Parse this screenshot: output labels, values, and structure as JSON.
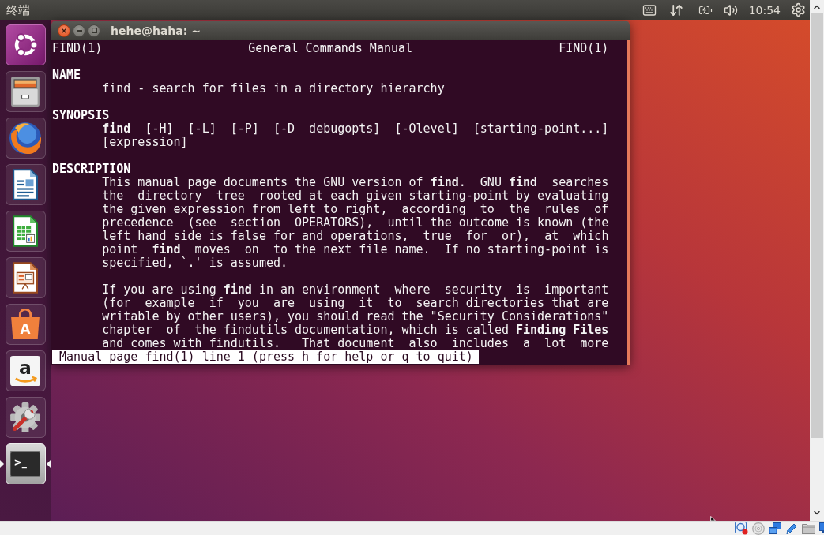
{
  "top_panel": {
    "app_title": "终端",
    "clock": "10:54"
  },
  "launcher": {
    "items": [
      {
        "kind": "dash",
        "running": false,
        "focused": false
      },
      {
        "kind": "files",
        "running": false,
        "focused": false
      },
      {
        "kind": "browser",
        "running": false,
        "focused": false
      },
      {
        "kind": "writer",
        "running": false,
        "focused": false
      },
      {
        "kind": "calc",
        "running": false,
        "focused": false
      },
      {
        "kind": "impress",
        "running": false,
        "focused": false
      },
      {
        "kind": "software",
        "glyph": "A",
        "running": false,
        "focused": false
      },
      {
        "kind": "store",
        "glyph": "a",
        "running": false,
        "focused": false
      },
      {
        "kind": "settings",
        "running": false,
        "focused": false
      },
      {
        "kind": "terminal",
        "glyph": ">_",
        "running": true,
        "focused": true
      }
    ]
  },
  "terminal": {
    "title": "hehe@haha: ~",
    "header": {
      "left": "FIND(1)",
      "center": "General Commands Manual",
      "right": "FIND(1)"
    },
    "sections": [
      {
        "heading": "NAME",
        "paragraphs": [
          {
            "lines": [
              "find - search for files in a directory hierarchy"
            ]
          }
        ]
      },
      {
        "heading": "SYNOPSIS",
        "paragraphs": [
          {
            "lines": [
              "**find**  [-H]  [-L]  [-P]  [-D  debugopts]  [-Olevel]  [starting-point...]",
              "[expression]"
            ]
          }
        ]
      },
      {
        "heading": "DESCRIPTION",
        "paragraphs": [
          {
            "lines": [
              "This manual page documents the GNU version of **find**.  GNU **find**  searches",
              "the  directory  tree  rooted at each given starting-point by evaluating",
              "the given expression from left to right,  according  to  the  rules  of",
              "precedence  (see  section  OPERATORS),  until the outcome is known (the",
              "left hand side is false for *and* operations,  true  for  *or*),  at  which",
              "point  **find**  moves  on  to the next file name.  If no starting-point is",
              "specified, `.' is assumed."
            ]
          },
          {
            "lines": [
              "If you are using **find** in an environment  where  security  is  important",
              "(for  example  if  you  are  using  it  to  search directories that are",
              "writable by other users), you should read the \"Security Considerations\"",
              "chapter  of  the findutils documentation, which is called **Finding Files**",
              "and comes with findutils.   That document  also  includes  a  lot  more"
            ]
          }
        ]
      }
    ],
    "status_line": "Manual page find(1) line 1 (press h for help or q to quit)"
  }
}
